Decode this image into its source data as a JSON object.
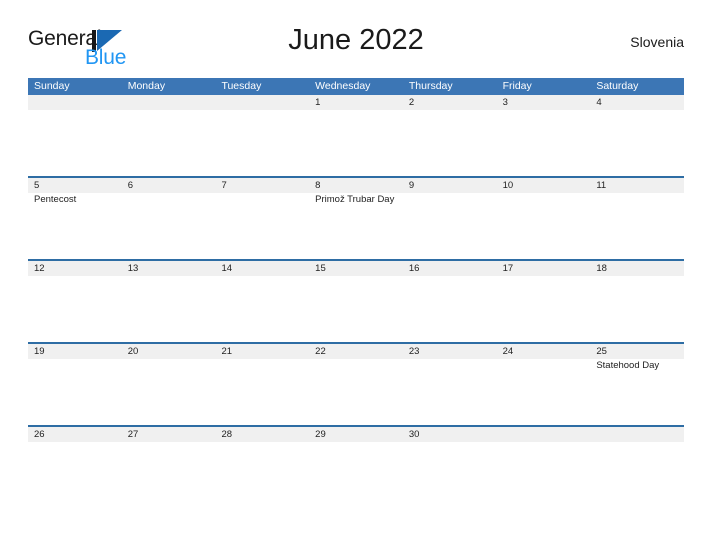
{
  "brand": {
    "name_top": "General",
    "name_bottom": "Blue",
    "mark": "flag-triangle",
    "color_blue": "#2196f3",
    "color_mark": "#1b69b3",
    "color_dark": "#1a1a1a"
  },
  "header": {
    "title": "June 2022",
    "region": "Slovenia"
  },
  "calendar": {
    "accent_header_color": "#3c76b5",
    "rule_color": "#2e6da4",
    "date_band_color": "#f0f0f0",
    "weekdays": [
      "Sunday",
      "Monday",
      "Tuesday",
      "Wednesday",
      "Thursday",
      "Friday",
      "Saturday"
    ],
    "weeks": [
      {
        "days": [
          {
            "date": "",
            "event": ""
          },
          {
            "date": "",
            "event": ""
          },
          {
            "date": "",
            "event": ""
          },
          {
            "date": "1",
            "event": ""
          },
          {
            "date": "2",
            "event": ""
          },
          {
            "date": "3",
            "event": ""
          },
          {
            "date": "4",
            "event": ""
          }
        ]
      },
      {
        "days": [
          {
            "date": "5",
            "event": "Pentecost"
          },
          {
            "date": "6",
            "event": ""
          },
          {
            "date": "7",
            "event": ""
          },
          {
            "date": "8",
            "event": "Primož Trubar Day"
          },
          {
            "date": "9",
            "event": ""
          },
          {
            "date": "10",
            "event": ""
          },
          {
            "date": "11",
            "event": ""
          }
        ]
      },
      {
        "days": [
          {
            "date": "12",
            "event": ""
          },
          {
            "date": "13",
            "event": ""
          },
          {
            "date": "14",
            "event": ""
          },
          {
            "date": "15",
            "event": ""
          },
          {
            "date": "16",
            "event": ""
          },
          {
            "date": "17",
            "event": ""
          },
          {
            "date": "18",
            "event": ""
          }
        ]
      },
      {
        "days": [
          {
            "date": "19",
            "event": ""
          },
          {
            "date": "20",
            "event": ""
          },
          {
            "date": "21",
            "event": ""
          },
          {
            "date": "22",
            "event": ""
          },
          {
            "date": "23",
            "event": ""
          },
          {
            "date": "24",
            "event": ""
          },
          {
            "date": "25",
            "event": "Statehood Day"
          }
        ]
      },
      {
        "days": [
          {
            "date": "26",
            "event": ""
          },
          {
            "date": "27",
            "event": ""
          },
          {
            "date": "28",
            "event": ""
          },
          {
            "date": "29",
            "event": ""
          },
          {
            "date": "30",
            "event": ""
          },
          {
            "date": "",
            "event": ""
          },
          {
            "date": "",
            "event": ""
          }
        ]
      }
    ]
  }
}
